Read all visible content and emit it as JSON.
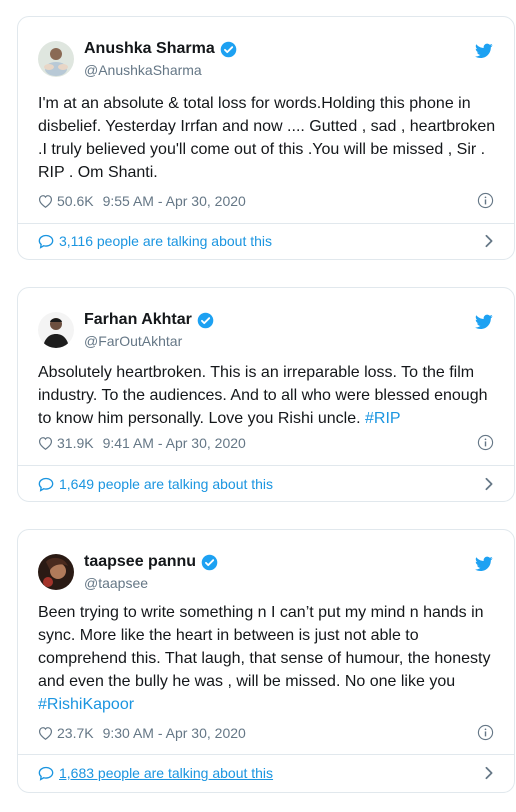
{
  "colors": {
    "accent": "#1da1f2",
    "link": "#1b95e0",
    "muted": "#657786",
    "border": "#e1e8ed"
  },
  "tweets": [
    {
      "name": "Anushka Sharma",
      "handle": "@AnushkaSharma",
      "text": "I'm at an absolute & total loss for words.Holding this phone in disbelief. Yesterday Irrfan and now .... Gutted , sad , heartbroken .I truly believed you'll come out of this .You will be missed , Sir . RIP . Om Shanti.",
      "hashtag": "",
      "likes": "50.6K",
      "time": "9:55 AM - Apr 30, 2020",
      "talking": "3,116 people are talking about this",
      "icons": [
        "heart-icon",
        "info-icon",
        "speech-bubble-icon",
        "chevron-right-icon",
        "twitter-bird-icon",
        "verified-badge-icon"
      ]
    },
    {
      "name": "Farhan Akhtar",
      "handle": "@FarOutAkhtar",
      "text": "Absolutely heartbroken. This is an irreparable loss. To the film industry. To the audiences. And to all who were blessed enough to know him personally. Love you Rishi uncle. ",
      "hashtag": "#RIP",
      "likes": "31.9K",
      "time": "9:41 AM - Apr 30, 2020",
      "talking": "1,649 people are talking about this"
    },
    {
      "name": "taapsee pannu",
      "handle": "@taapsee",
      "text": "Been trying to write something n I can’t put my mind n hands in sync. More like the heart in between is just not able to comprehend this. That laugh, that sense of humour, the honesty and even the bully he was , will be missed. No one like you ",
      "hashtag": "#RishiKapoor",
      "likes": "23.7K",
      "time": "9:30 AM - Apr 30, 2020",
      "talking": "1,683 people are talking about this"
    }
  ]
}
